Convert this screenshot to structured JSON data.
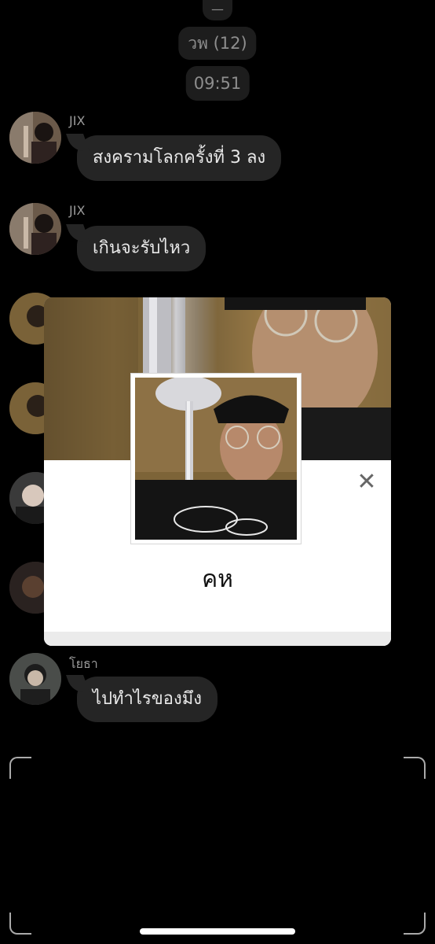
{
  "chat": {
    "top_pill": "—",
    "group_label": "วพ (12)",
    "time_label": "09:51",
    "messages": [
      {
        "sender": "JIX",
        "text": "สงครามโลกครั้งที่ 3 ลง"
      },
      {
        "sender": "JIX",
        "text": "เกินจะรับไหว"
      },
      {
        "sender": "โยธา",
        "text": "ไปทำไรของมึง"
      }
    ]
  },
  "profile_popup": {
    "name": "คห",
    "close_icon": "close-icon"
  }
}
